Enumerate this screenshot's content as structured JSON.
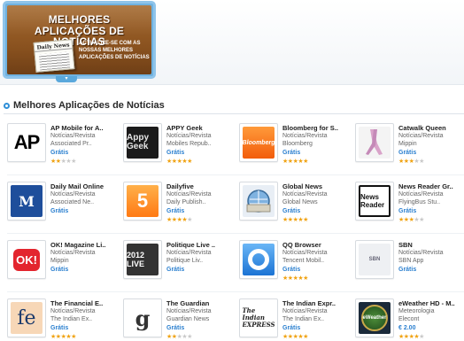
{
  "banner": {
    "title_line1": "MELHORES",
    "title_line2": "APLICAÇÕES DE NOTÍCIAS",
    "paper_head": "Daily News",
    "subtitle": "ACTUALIZE-SE COM AS NOSSAS MELHORES APLICAÇÕES DE NOTÍCIAS",
    "accent_color": "#8fc4ea",
    "background_color": "#8a521f"
  },
  "section": {
    "title": "Melhores Aplicações de Notícias",
    "bullet_color": "#2f8fd8"
  },
  "apps": [
    [
      {
        "name": "AP Mobile for A..",
        "category": "Notícias/Revista",
        "developer": "Associated Pr..",
        "price": "Grátis",
        "rating": 2.5,
        "icon": "ap-icon",
        "icon_text": "AP"
      },
      {
        "name": "APPY Geek",
        "category": "Notícias/Revista",
        "developer": "Mobiles Repub..",
        "price": "Grátis",
        "rating": 5,
        "icon": "appy-geek-icon",
        "icon_text": "Appy Geek"
      },
      {
        "name": "Bloomberg for S..",
        "category": "Notícias/Revista",
        "developer": "Bloomberg",
        "price": "Grátis",
        "rating": 5,
        "icon": "bloomberg-icon",
        "icon_text": "Bloomberg"
      },
      {
        "name": "Catwalk Queen",
        "category": "Notícias/Revista",
        "developer": "Mippin",
        "price": "Grátis",
        "rating": 3.5,
        "icon": "catwalk-icon",
        "icon_text": ""
      }
    ],
    [
      {
        "name": "Daily Mail Online",
        "category": "Notícias/Revista",
        "developer": "Associated Ne..",
        "price": "Grátis",
        "rating": 0,
        "icon": "daily-mail-icon",
        "icon_text": "M"
      },
      {
        "name": "Dailyfive",
        "category": "Notícias/Revista",
        "developer": "Daily Publish..",
        "price": "Grátis",
        "rating": 4.5,
        "icon": "dailyfive-icon",
        "icon_text": "5"
      },
      {
        "name": "Global News",
        "category": "Notícias/Revista",
        "developer": "Global News",
        "price": "Grátis",
        "rating": 5,
        "icon": "global-news-icon",
        "icon_text": ""
      },
      {
        "name": "News Reader Gr..",
        "category": "Notícias/Revista",
        "developer": "FlyingBus Stu..",
        "price": "Grátis",
        "rating": 3,
        "icon": "news-reader-icon",
        "icon_text": "News Reader"
      }
    ],
    [
      {
        "name": "OK! Magazine Li..",
        "category": "Notícias/Revista",
        "developer": "Mippin",
        "price": "Grátis",
        "rating": 0,
        "icon": "ok-magazine-icon",
        "icon_text": "OK!"
      },
      {
        "name": "Politique Live ..",
        "category": "Notícias/Revista",
        "developer": "Politique Liv..",
        "price": "Grátis",
        "rating": 0,
        "icon": "politique-live-icon",
        "icon_text": "2012 LIVE"
      },
      {
        "name": "QQ Browser",
        "category": "Notícias/Revista",
        "developer": "Tencent Mobil..",
        "price": "Grátis",
        "rating": 5,
        "icon": "qq-browser-icon",
        "icon_text": ""
      },
      {
        "name": "SBN",
        "category": "Notícias/Revista",
        "developer": "SBN App",
        "price": "Grátis",
        "rating": 0,
        "icon": "sbn-icon",
        "icon_text": "SBN"
      }
    ],
    [
      {
        "name": "The Financial E..",
        "category": "Notícias/Revista",
        "developer": "The Indian Ex..",
        "price": "Grátis",
        "rating": 5,
        "icon": "financial-express-icon",
        "icon_text": "fe"
      },
      {
        "name": "The Guardian",
        "category": "Notícias/Revista",
        "developer": "Guardian News",
        "price": "Grátis",
        "rating": 2.5,
        "icon": "guardian-icon",
        "icon_text": "g"
      },
      {
        "name": "The Indian Expr..",
        "category": "Notícias/Revista",
        "developer": "The Indian Ex..",
        "price": "Grátis",
        "rating": 5,
        "icon": "indian-express-icon",
        "icon_text": "The Indian EXPRESS"
      },
      {
        "name": "eWeather HD - M..",
        "category": "Meteorologia",
        "developer": "Elecont",
        "price": "€ 2.00",
        "rating": 4.5,
        "icon": "eweather-icon",
        "icon_text": "eWeather"
      }
    ]
  ]
}
